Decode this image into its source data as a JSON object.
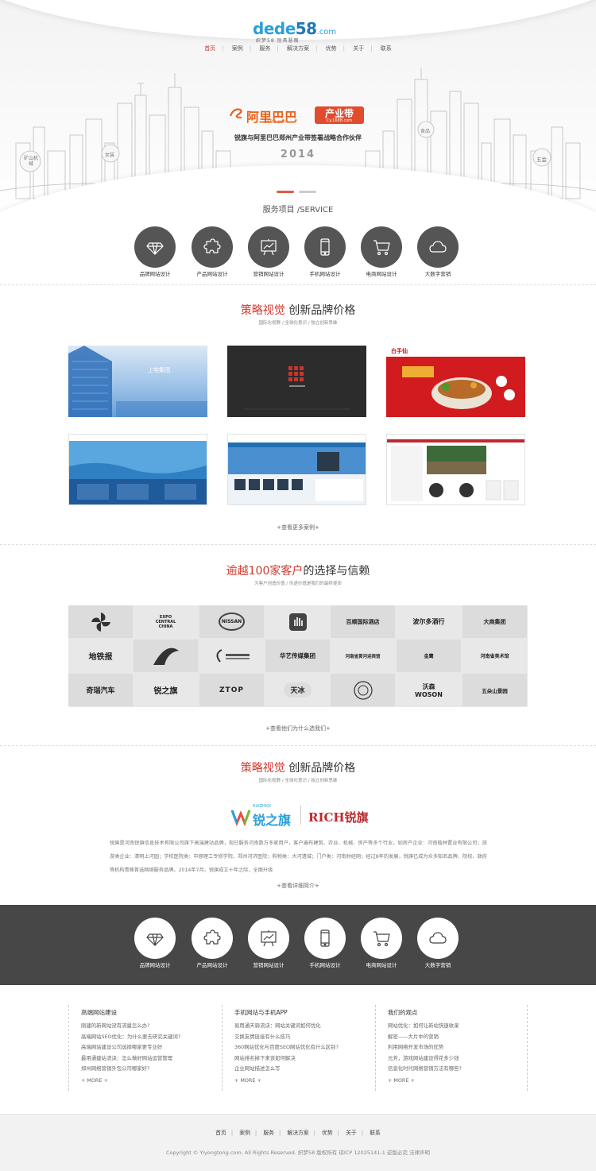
{
  "logo": {
    "brand_a": "dede",
    "brand_b": "58",
    "domain": ".com",
    "tagline": "织梦58 别具慧眼"
  },
  "nav": [
    "首页",
    "案例",
    "服务",
    "解决方案",
    "优势",
    "关于",
    "联系"
  ],
  "hero": {
    "partner_a": "阿里巴巴",
    "partner_a_sub": "1688.com",
    "partner_b": "产业带",
    "partner_b_sub": "Cy.1688.com",
    "caption": "锐旗与阿里巴巴郑州产业带签署战略合作伙伴",
    "year": "2014",
    "bubbles": [
      "矿山机械",
      "女装",
      "食品",
      "五金"
    ]
  },
  "services": {
    "title": "服务项目 /SERVICE",
    "items": [
      {
        "label": "品牌网站设计",
        "icon": "diamond-icon"
      },
      {
        "label": "产品网站设计",
        "icon": "puzzle-icon"
      },
      {
        "label": "营销网站设计",
        "icon": "presentation-icon"
      },
      {
        "label": "手机网站设计",
        "icon": "phone-icon"
      },
      {
        "label": "电商网站设计",
        "icon": "cart-icon"
      },
      {
        "label": "大数字营销",
        "icon": "cloud-icon"
      }
    ]
  },
  "cases": {
    "title_red": "策略视觉",
    "title_rest": " 创新品牌价格",
    "subtitle": "国际化视野 / 全球化意识 / 独立创新思维",
    "items": [
      {
        "caption": "上宅集团"
      },
      {
        "caption": ""
      },
      {
        "caption": "白手仙"
      },
      {
        "caption": ""
      },
      {
        "caption": ""
      },
      {
        "caption": ""
      }
    ],
    "more": "+查看更多案例+"
  },
  "clients": {
    "title_red": "逾越100家客户",
    "title_rest": "的选择与信赖",
    "subtitle": "为客户创造价值 / 传递价值是我们的最终使命",
    "logos": [
      "",
      "EXPO CENTRAL CHINA",
      "NISSAN",
      "",
      "百顺国际酒店",
      "波尔多酒行",
      "大商集团",
      "地铁报",
      "",
      "",
      "华艺传媒集团",
      "河南省黄河迎宾馆",
      "金鹰",
      "河南省美术馆",
      "奇瑞汽车",
      "锐之旗",
      "ZTOP",
      "天冰",
      "",
      "沃森 WOSON",
      "五朵山景园"
    ],
    "more": "+查看他们为什么选我们+"
  },
  "about": {
    "title_red": "策略视觉",
    "title_rest": " 创新品牌价格",
    "subtitle": "国际化视野 / 全球化意识 / 独立创新思维",
    "logo_a": "锐之旗",
    "logo_a_top": "RUIZHIQI",
    "logo_b": "RICH锐旗",
    "text": "锐旗是河南锐旗信息技术有限公司旗下高端建站品牌，现已服务河南数万多家用户，客户遍布建筑、农业、机械、房产等多个行业，如房产企业：河南楷林置业有限公司；旅游类企业：清明上河园；学校医院类：中原理工专修学院、郑州河济医院；购物类：大河遗城；门户类：河南财经网；经过8年的发展，锐旗已成为众多知名品牌、院校、政府等机构青睐首选网络服务品牌。2014年7月，锐旗成立十年之际，全面升级",
    "more": "+查看详细简介+"
  },
  "columns": [
    {
      "title": "高端网站建设",
      "items": [
        "刚建的新网站没有流量怎么办?",
        "高端网站SEO优化：为什么要去研究关键词?",
        "高端网站建设公司选择哪家更专业好",
        "最用通建站流诀：怎么做好网站运营管理",
        "郑州网络营销外包公司哪家好?"
      ],
      "more": "+ MORE +"
    },
    {
      "title": "手机网站与手机APP",
      "items": [
        "易用通天骑流诀：网站关键词如何优化",
        "交换友情链接有什么技巧",
        "360网站优化与百度SEO网站优化有什么区别?",
        "网站排名掉下来该如何解决",
        "企业网站描述怎么写"
      ],
      "more": "+ MORE +"
    },
    {
      "title": "我们的观点",
      "items": [
        "网站优化：如何让新站快速收录",
        "解密——大片中的营销",
        "利用网络开发市场的优势",
        "元芳，游戏网站建设得花多少钱",
        "信息化时代网络营销方法有哪些?"
      ],
      "more": "+ MORE +"
    }
  ],
  "footer": {
    "nav": [
      "首页",
      "案例",
      "服务",
      "解决方案",
      "优势",
      "关于",
      "联系"
    ],
    "copyright": "Copyright © Yiyongtong.com. All Rights Reserved. 织梦58 版权所有 琼ICP 12025141-1 逆版必究 法律声明"
  },
  "colors": {
    "accent": "#d0372c",
    "dark_band": "#474747",
    "icon_bg": "#555555",
    "logo_blue": "#2aa0d8"
  }
}
